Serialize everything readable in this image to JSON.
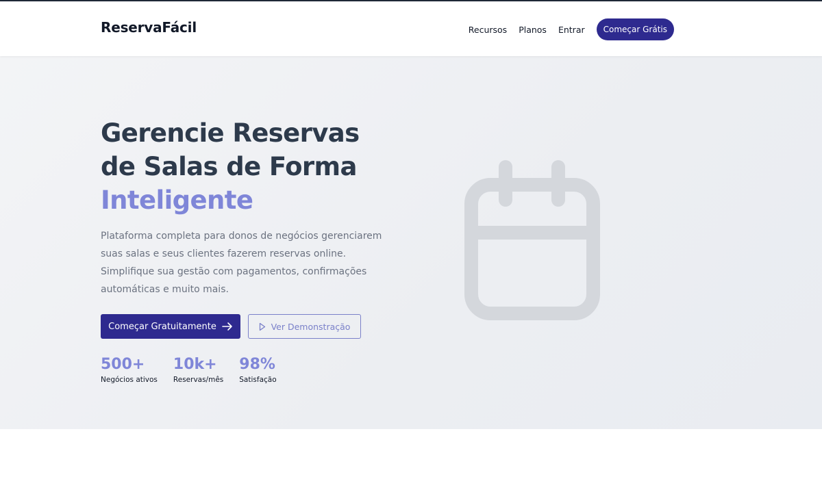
{
  "header": {
    "brand": "ReservaFácil",
    "nav": {
      "recursos": "Recursos",
      "planos": "Planos",
      "entrar": "Entrar",
      "cta": "Começar Grátis"
    }
  },
  "hero": {
    "title_line1": "Gerencie Reservas",
    "title_line2": "de Salas de Forma",
    "title_highlight": "Inteligente",
    "description": "Plataforma completa para donos de negócios gerenciarem suas salas e seus clientes fazerem reservas online. Simplifique sua gestão com pagamentos, confirmações automáticas e muito mais.",
    "primary_button": "Começar Gratuitamente",
    "secondary_button": "Ver Demonstração",
    "stats": [
      {
        "value": "500+",
        "label": "Negócios ativos"
      },
      {
        "value": "10k+",
        "label": "Reservas/mês"
      },
      {
        "value": "98%",
        "label": "Satisfação"
      }
    ],
    "illustration_icon": "calendar-icon"
  },
  "colors": {
    "brand_primary": "#2e2a8f",
    "accent": "#7f86d8",
    "heading": "#2d3a4b",
    "body_text": "#6b7280",
    "hero_bg": "#eceef2",
    "icon_gray": "#d4d7dc"
  }
}
